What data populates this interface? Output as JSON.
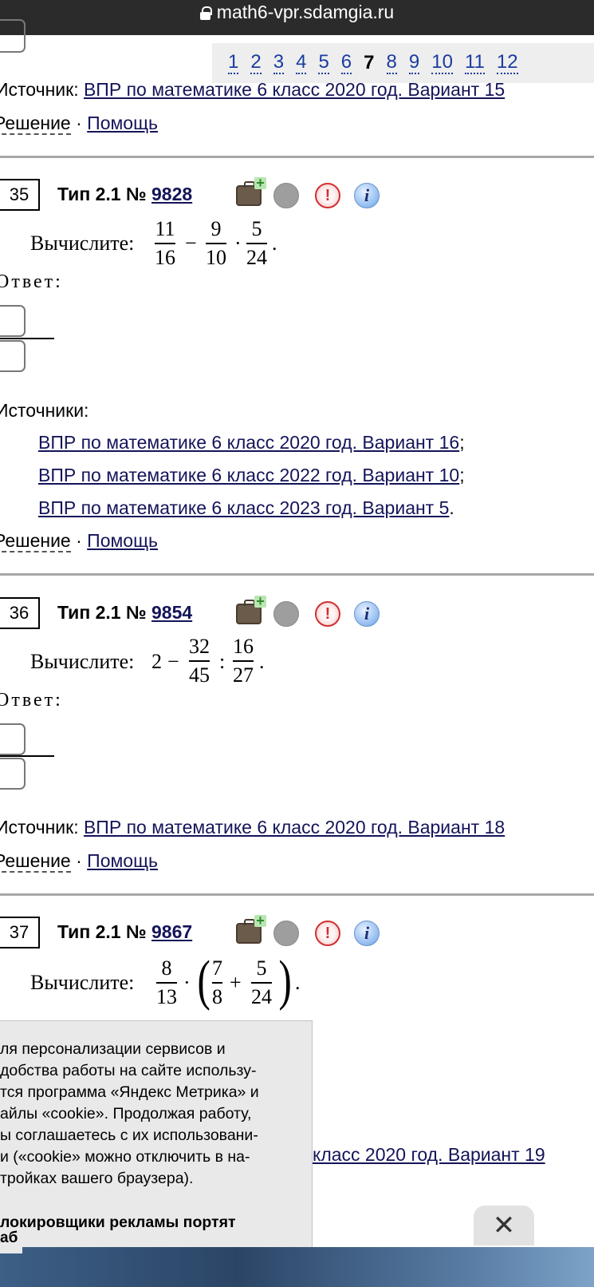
{
  "browser": {
    "url": "math6-vpr.sdamgia.ru"
  },
  "pagination": {
    "pages": [
      "1",
      "2",
      "3",
      "4",
      "5",
      "6",
      "7",
      "8",
      "9",
      "10",
      "11",
      "12"
    ],
    "current": "7"
  },
  "top_section": {
    "source_label": "Источник:",
    "source_link": "ВПР по математике 6 класс 2020 год. Вариант 15",
    "solution": "Решение",
    "sep": "·",
    "help": "Помощь"
  },
  "tasks": [
    {
      "num": "35",
      "type_label": "Тип 2.1 №",
      "id": "9828",
      "prompt": "Вычислите:",
      "expr": {
        "f1n": "11",
        "f1d": "16",
        "op1": "−",
        "f2n": "9",
        "f2d": "10",
        "op2": "·",
        "f3n": "5",
        "f3d": "24",
        "end": "."
      },
      "answer_label": "Ответ:",
      "sources_label": "Источники:",
      "sources": [
        {
          "text": "ВПР по математике 6 класс 2020 год. Вариант 16",
          "suffix": ";"
        },
        {
          "text": "ВПР по математике 6 класс 2022 год. Вариант 10",
          "suffix": ";"
        },
        {
          "text": "ВПР по математике 6 класс 2023 год. Вариант 5",
          "suffix": "."
        }
      ],
      "solution": "Решение",
      "sep": "·",
      "help": "Помощь"
    },
    {
      "num": "36",
      "type_label": "Тип 2.1 №",
      "id": "9854",
      "prompt": "Вычислите:",
      "expr": {
        "lead": "2",
        "op1": "−",
        "f1n": "32",
        "f1d": "45",
        "op2": ":",
        "f2n": "16",
        "f2d": "27",
        "end": "."
      },
      "answer_label": "Ответ:",
      "source_label": "Источник:",
      "source_link": "ВПР по математике 6 класс 2020 год. Вариант 18",
      "solution": "Решение",
      "sep": "·",
      "help": "Помощь"
    },
    {
      "num": "37",
      "type_label": "Тип 2.1 №",
      "id": "9867",
      "prompt": "Вычислите:",
      "expr": {
        "f1n": "8",
        "f1d": "13",
        "op1": "·",
        "lparen": "(",
        "f2n": "7",
        "f2d": "8",
        "op2": "+",
        "f3n": "5",
        "f3d": "24",
        "rparen": ")",
        "end": "."
      },
      "source_partial": "класс 2020 год. Вариант 19"
    }
  ],
  "icons": [
    "briefcase-add-icon",
    "status-circle-icon",
    "report-error-icon",
    "info-icon"
  ],
  "icon_glyphs": {
    "warn": "!",
    "info": "i"
  },
  "cookie": {
    "lines": [
      "ля персонализации сервисов и",
      "добства работы на сайте использу-",
      "тся программа «Яндекс Метрика» и",
      "айлы «cookie». Продолжая работу,",
      "ы соглашаетесь с их использовани-",
      "и («cookie» можно отключить в на-",
      "тройках вашего браузера)."
    ],
    "bold_line": "локировщики рекламы портят",
    "bottom_cap": "аб",
    "close": "✕"
  },
  "colors": {
    "link": "#14145a",
    "pager_link": "#1a3ca0",
    "rule": "#a8a8a8",
    "urlbar": "#2b2b2b"
  }
}
